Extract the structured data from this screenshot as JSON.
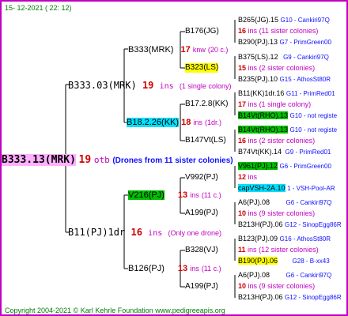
{
  "header": {
    "date": "15-  12-2021 ( 22: 12)"
  },
  "footer": {
    "copyright": "Copyright 2004-2021 © Karl Kehrle Foundation    www.pedigreeapis.org"
  },
  "root": {
    "id": "B333.13(MRK)",
    "ins": "19",
    "ins_label": "otb",
    "note": "(Drones from 11 sister colonies)"
  },
  "mother": {
    "id": "B333.03(MRK)",
    "ins": "19",
    "ins_label": "ins",
    "note": "(1 single colony)"
  },
  "father": {
    "id": "B11(PJ)1dr",
    "ins": "16",
    "ins_label": "ins",
    "note": "(Only one drone)"
  },
  "gen3": [
    {
      "id": "B333(MRK)",
      "ins": "17",
      "ins_label": "knw",
      "note": "(20 c.)"
    },
    {
      "id": "B18.2.26(KK)",
      "ins": "18",
      "ins_label": "ins",
      "note": "(1dr.)"
    },
    {
      "id": "V216(PJ)",
      "ins": "13",
      "ins_label": "ins",
      "note": "(11 c.)"
    },
    {
      "id": "B126(PJ)",
      "ins": "13",
      "ins_label": "ins",
      "note": "(11 c.)"
    }
  ],
  "gen4": [
    {
      "id": "B176(JG)"
    },
    {
      "id": "B323(LS)"
    },
    {
      "id": "B17.2.8(KK)"
    },
    {
      "id": "B147Vt(LS)"
    },
    {
      "id": "V992(PJ)"
    },
    {
      "id": "A199(PJ)"
    },
    {
      "id": "B328(VJ)"
    },
    {
      "id": "A199(PJ)"
    }
  ],
  "gen5": [
    {
      "top": "B265(JG).15",
      "top_right": "G10 - Cankiri97Q",
      "ins": "16",
      "ins_label": "ins",
      "note": "(11 sister colonies)",
      "bottom": "B290(PJ).13",
      "bottom_right": "G7 - PrimGreen00"
    },
    {
      "top": "B375(LS).12",
      "top_right": "G9 - Cankiri97Q",
      "ins": "15",
      "ins_label": "ins",
      "note": "(2 sister colonies)",
      "bottom": "B235(PJ).10",
      "bottom_right": "G15 - AthosSt80R"
    },
    {
      "top": "B11(KK)1dr.16",
      "top_right": "G11 - PrimRed01",
      "ins": "17",
      "ins_label": "ins",
      "note": "(1 single colony)",
      "bottom": "B14Vt(RHO).13",
      "bottom_right": "G10 - not registe"
    },
    {
      "top": "B14Vt(RHO).13",
      "top_right": "G10 - not registe",
      "ins": "16",
      "ins_label": "ins",
      "note": "(2 sister colonies)",
      "bottom": "B74Vt(KK).14",
      "bottom_right": "G9 - PrimRed01"
    },
    {
      "top": "V961(PJ).12",
      "top_right": "G6 - PrimGreen00",
      "ins": "12",
      "ins_label": "ins",
      "note": "",
      "bottom": "capVSH-2A.10",
      "bottom_right": "1 - VSH-Pool-AR"
    },
    {
      "top": "A6(PJ).08",
      "top_right": "G6 - Cankiri97Q",
      "ins": "10",
      "ins_label": "ins",
      "note": "(9 sister colonies)",
      "bottom": "B213H(PJ).06",
      "bottom_right": "G12 - SinopEgg86R"
    },
    {
      "top": "B123(PJ).09",
      "top_right": "G16 - AthosSt80R",
      "ins": "11",
      "ins_label": "ins",
      "note": "(12 sister colonies)",
      "bottom": "B190(PJ).06",
      "bottom_right": "G28 - B-xx43"
    },
    {
      "top": "A6(PJ).08",
      "top_right": "G6 - Cankiri97Q",
      "ins": "10",
      "ins_label": "ins",
      "note": "(9 sister colonies)",
      "bottom": "B213H(PJ).06",
      "bottom_right": "G12 - SinopEgg86R"
    }
  ]
}
